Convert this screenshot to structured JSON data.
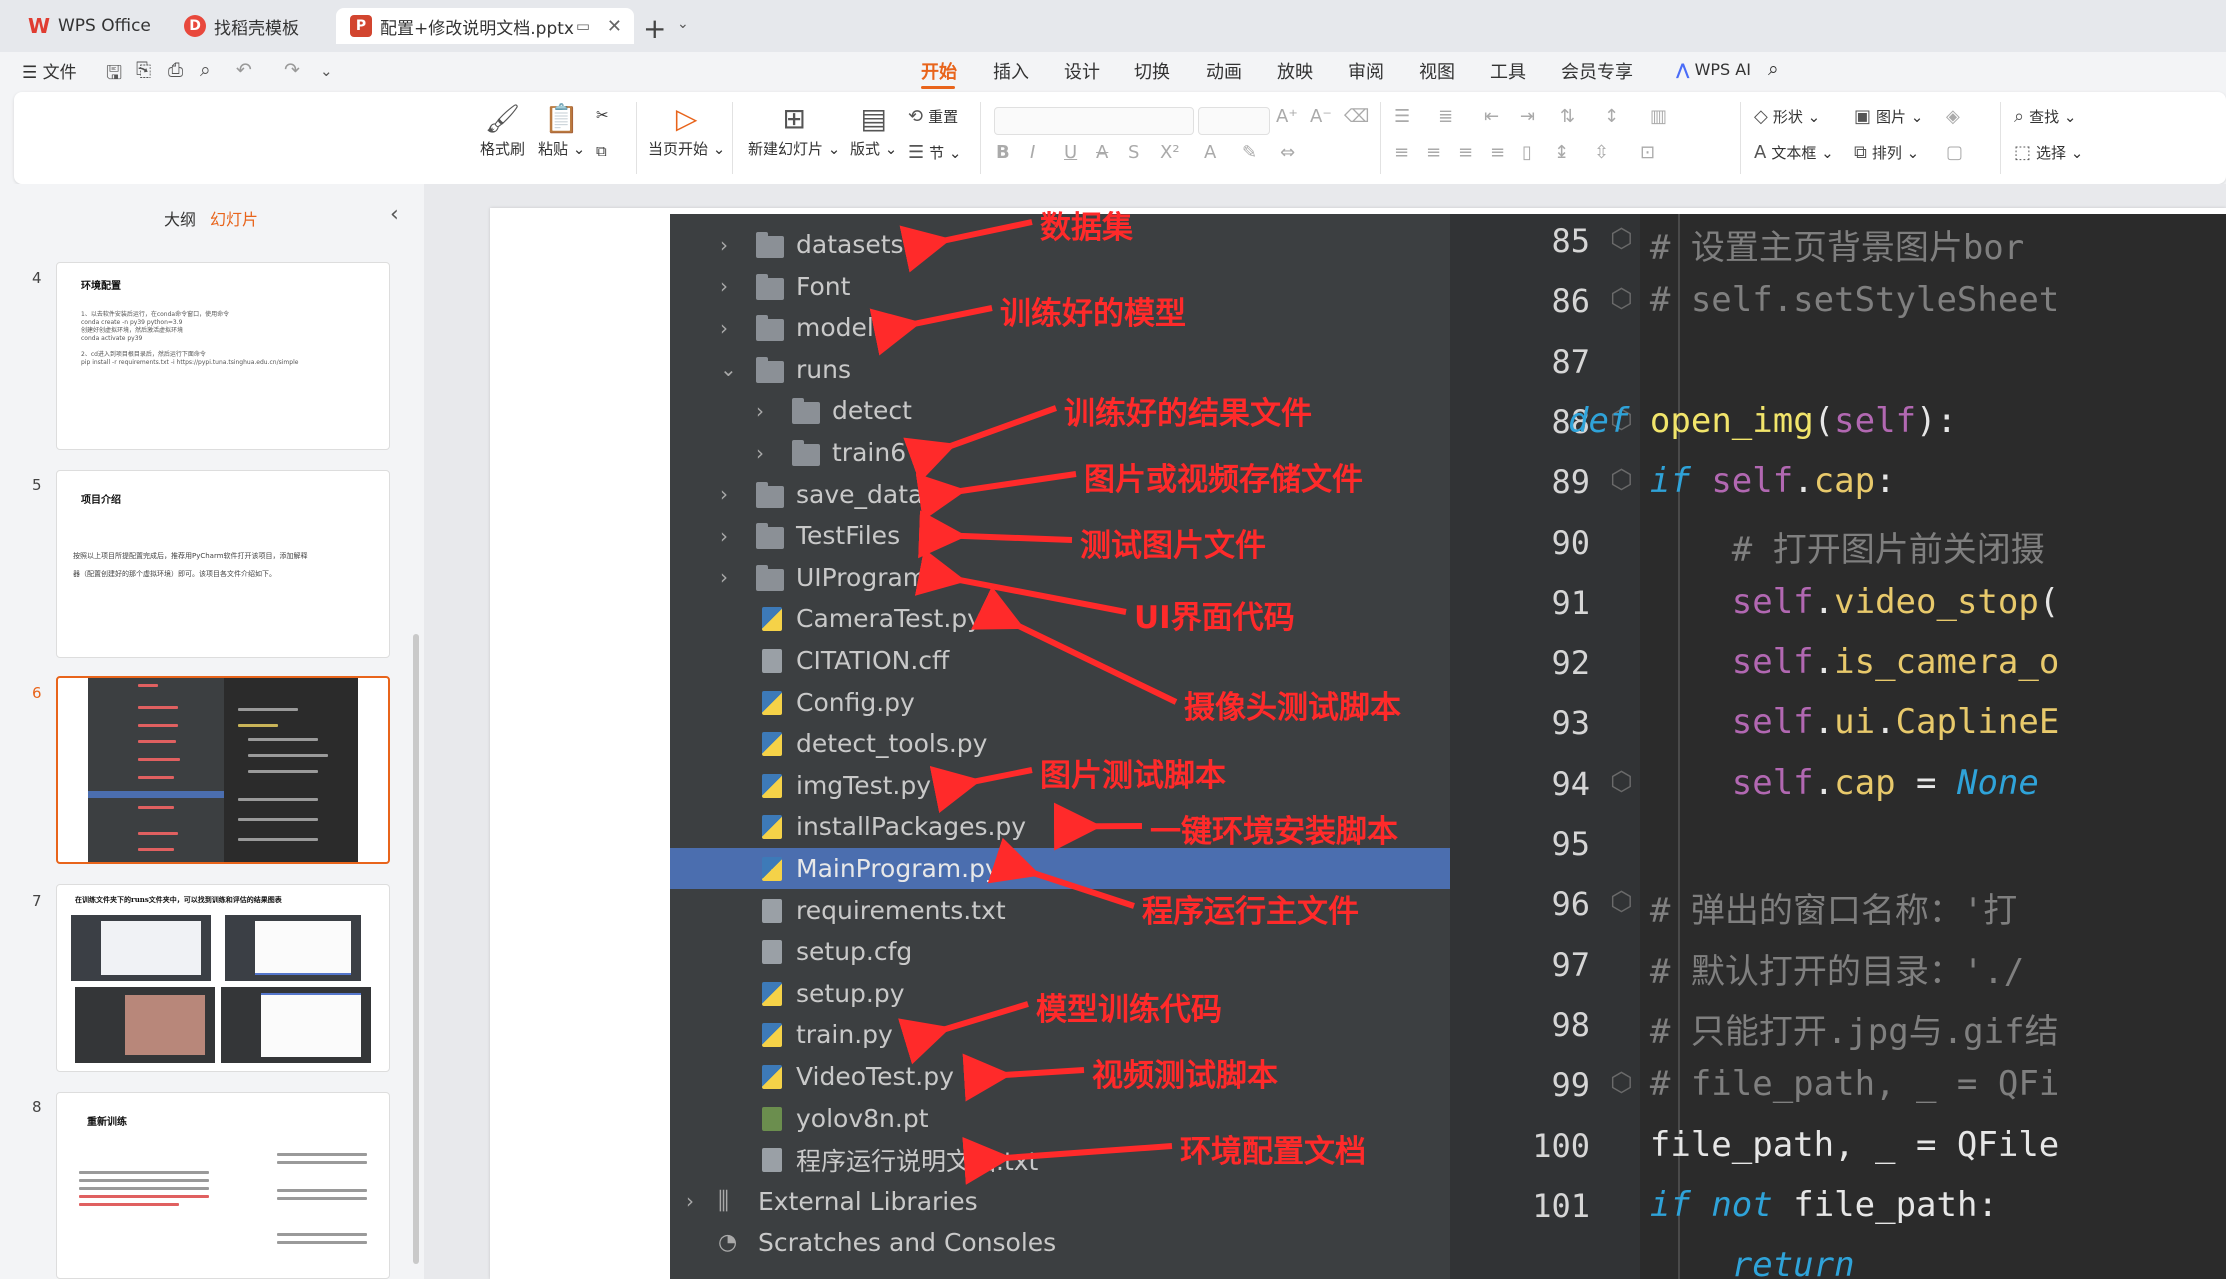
{
  "titlebar": {
    "tabs": [
      {
        "label": "WPS Office",
        "icon": "wps-logo-icon"
      },
      {
        "label": "找稻壳模板",
        "icon": "docer-icon"
      },
      {
        "label": "配置+修改说明文档.pptx",
        "icon": "ppt-file-icon",
        "active": true
      }
    ]
  },
  "menu": {
    "file_label": "文件",
    "tabs": [
      "开始",
      "插入",
      "设计",
      "切换",
      "动画",
      "放映",
      "审阅",
      "视图",
      "工具",
      "会员专享"
    ],
    "active_tab": "开始",
    "wps_ai": "WPS AI"
  },
  "ribbon": {
    "format_painter": "格式刷",
    "paste": "粘贴",
    "play_from_current": "当页开始",
    "new_slide": "新建幻灯片",
    "layout": "版式",
    "reset": "重置",
    "section": "节",
    "shape": "形状",
    "picture": "图片",
    "textbox": "文本框",
    "arrange": "排列",
    "find": "查找",
    "select": "选择"
  },
  "left_panel": {
    "tab_outline": "大纲",
    "tab_slides": "幻灯片",
    "slides": [
      {
        "number": "4",
        "title": "环境配置"
      },
      {
        "number": "5",
        "title": "项目介绍"
      },
      {
        "number": "6",
        "title": "",
        "active": true
      },
      {
        "number": "7",
        "title": "在训练文件夹下的runs文件夹中，可以找到训练和评估的结果图表"
      },
      {
        "number": "8",
        "title": "重新训练"
      }
    ],
    "slide4_text": [
      "1、以去软件安装后运行，在conda命令窗口，使用命令",
      "conda create -n py39 python=3.9",
      "创建好创虚拟环境，然后激活虚拟环境",
      "conda activate py39",
      "2、cd进入到项目根目录后，然后运行下面命令",
      "pip install -r requirements.txt -i https://pypi.tuna.tsinghua.edu.cn/simple"
    ],
    "slide5_text": [
      "按照以上项目所提配置完成后，推荐用PyCharm软件打开该项目，添加解释",
      "器（配置创建好的那个虚拟环境）即可。该项目各文件介绍如下。"
    ]
  },
  "ide": {
    "tree": [
      {
        "name": "datasets",
        "type": "folder",
        "expanded": false,
        "indent": 0
      },
      {
        "name": "Font",
        "type": "folder",
        "expanded": false,
        "indent": 0
      },
      {
        "name": "models",
        "type": "folder",
        "expanded": false,
        "indent": 0
      },
      {
        "name": "runs",
        "type": "folder",
        "expanded": true,
        "indent": 0
      },
      {
        "name": "detect",
        "type": "folder",
        "expanded": false,
        "indent": 1
      },
      {
        "name": "train6",
        "type": "folder",
        "expanded": false,
        "indent": 1
      },
      {
        "name": "save_data",
        "type": "folder",
        "expanded": false,
        "indent": 0
      },
      {
        "name": "TestFiles",
        "type": "folder",
        "expanded": false,
        "indent": 0
      },
      {
        "name": "UIProgram",
        "type": "folder-special",
        "expanded": false,
        "indent": 0
      },
      {
        "name": "CameraTest.py",
        "type": "py",
        "indent": 0
      },
      {
        "name": "CITATION.cff",
        "type": "txt",
        "indent": 0
      },
      {
        "name": "Config.py",
        "type": "py",
        "indent": 0
      },
      {
        "name": "detect_tools.py",
        "type": "py",
        "indent": 0
      },
      {
        "name": "imgTest.py",
        "type": "py",
        "indent": 0
      },
      {
        "name": "installPackages.py",
        "type": "py",
        "indent": 0
      },
      {
        "name": "MainProgram.py",
        "type": "py",
        "indent": 0,
        "selected": true
      },
      {
        "name": "requirements.txt",
        "type": "txt",
        "indent": 0
      },
      {
        "name": "setup.cfg",
        "type": "cfg",
        "indent": 0
      },
      {
        "name": "setup.py",
        "type": "py",
        "indent": 0
      },
      {
        "name": "train.py",
        "type": "py",
        "indent": 0
      },
      {
        "name": "VideoTest.py",
        "type": "py",
        "indent": 0
      },
      {
        "name": "yolov8n.pt",
        "type": "pt",
        "indent": 0
      },
      {
        "name": "程序运行说明文档.txt",
        "type": "txt",
        "indent": 0
      },
      {
        "name": "External Libraries",
        "type": "lib",
        "indent": -1
      },
      {
        "name": "Scratches and Consoles",
        "type": "scratch",
        "indent": -1
      }
    ],
    "line_numbers": [
      "85",
      "86",
      "87",
      "88",
      "89",
      "90",
      "91",
      "92",
      "93",
      "94",
      "95",
      "96",
      "97",
      "98",
      "99",
      "100",
      "101"
    ],
    "code_lines": [
      "    # 设置主页背景图片bor",
      "    # self.setStyleSheet",
      "",
      "def open_img(self):",
      "    if self.cap:",
      "        # 打开图片前关闭摄",
      "        self.video_stop(",
      "        self.is_camera_o",
      "        self.ui.CaplineE",
      "        self.cap = None",
      "",
      "    # 弹出的窗口名称：'打",
      "    # 默认打开的目录：'./",
      "    # 只能打开.jpg与.gif结",
      "    # file_path, _ = QFi",
      "    file_path, _ = QFile",
      "    if not file_path:",
      "        return"
    ]
  },
  "annotations": [
    {
      "text": "数据集",
      "target": "datasets"
    },
    {
      "text": "训练好的模型",
      "target": "models"
    },
    {
      "text": "训练好的结果文件",
      "target": "train6"
    },
    {
      "text": "图片或视频存储文件",
      "target": "save_data"
    },
    {
      "text": "测试图片文件",
      "target": "TestFiles"
    },
    {
      "text": "UI界面代码",
      "target": "UIProgram"
    },
    {
      "text": "摄像头测试脚本",
      "target": "CameraTest.py"
    },
    {
      "text": "图片测试脚本",
      "target": "imgTest.py"
    },
    {
      "text": "一键环境安装脚本",
      "target": "installPackages.py"
    },
    {
      "text": "程序运行主文件",
      "target": "MainProgram.py"
    },
    {
      "text": "模型训练代码",
      "target": "train.py"
    },
    {
      "text": "视频测试脚本",
      "target": "VideoTest.py"
    },
    {
      "text": "环境配置文档",
      "target": "程序运行说明文档.txt"
    }
  ],
  "colors": {
    "accent": "#e8641b",
    "annotation_red": "#ff2a2a",
    "ide_tree_bg": "#3c3f41",
    "ide_editor_bg": "#2b2b2b",
    "selected_row": "#4b6eaf"
  }
}
